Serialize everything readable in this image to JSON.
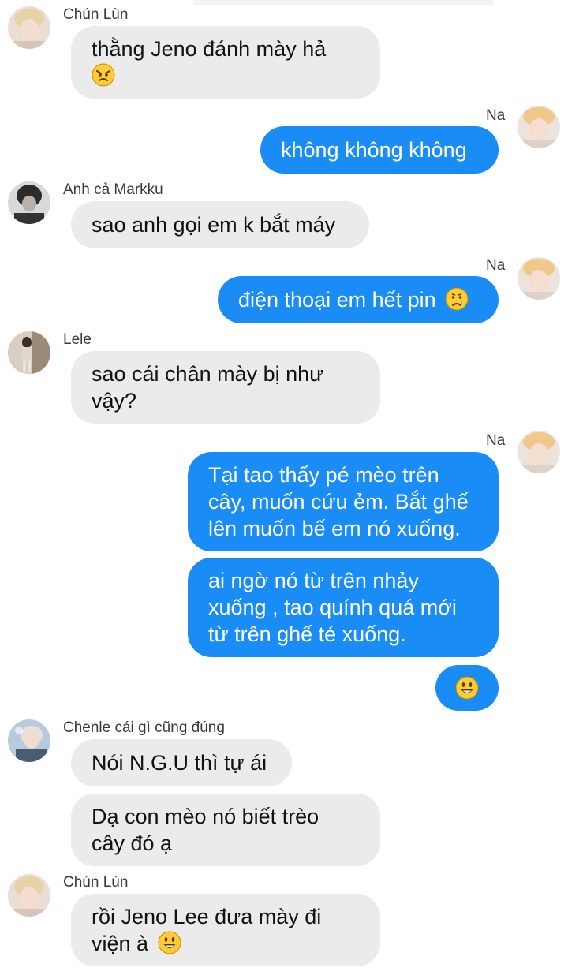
{
  "colors": {
    "incoming_bubble": "#ebebeb",
    "outgoing_bubble": "#1a8cf6",
    "outgoing_text": "#ffffff",
    "incoming_text": "#121212"
  },
  "messages": [
    {
      "sender": "Chún Lùn",
      "text": "thằng Jeno đánh mày hả",
      "emoji": "angry-face-icon"
    },
    {
      "sender": "Na",
      "text": "không không không"
    },
    {
      "sender": "Anh cả Markku",
      "text": "sao anh gọi em k bắt máy"
    },
    {
      "sender": "Na",
      "text": "điện thoại em hết pin",
      "emoji": "crying-face-icon"
    },
    {
      "sender": "Lele",
      "line1": "sao cái chân mày bị như",
      "line2": "vậy?"
    },
    {
      "sender": "Na",
      "line1": "Tại tao thấy pé mèo trên",
      "line2": "cây, muốn cứu ẻm. Bắt ghế",
      "line3": "lên muốn bế em nó xuống."
    },
    {
      "line1": "ai ngờ nó từ trên nhảy",
      "line2": "xuống , tao quính quá mới",
      "line3": "từ trên ghế té xuống."
    },
    {
      "emoji": "smiley-face-icon"
    },
    {
      "sender": "Chenle cái gì cũng đúng",
      "text": "Nói N.G.U thì tự ái"
    },
    {
      "line1": "Dạ con mèo nó biết trèo",
      "line2": "cây đó ạ"
    },
    {
      "sender": "Chún Lùn",
      "line1": "rồi Jeno Lee đưa mày đi",
      "line2": "viện à",
      "emoji": "smiley-face-icon"
    }
  ]
}
